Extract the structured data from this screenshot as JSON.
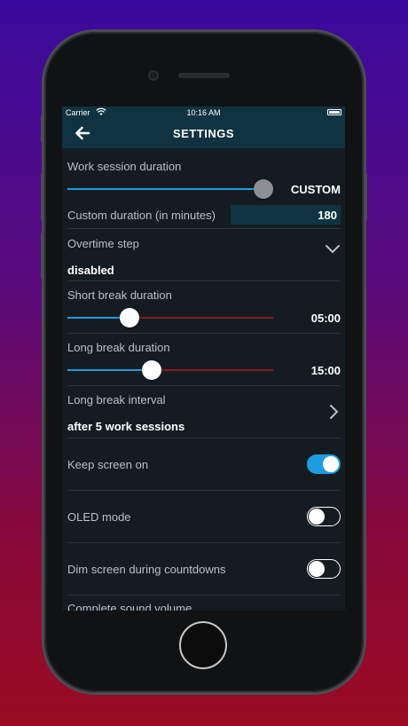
{
  "status": {
    "carrier": "Carrier",
    "time": "10:16 AM"
  },
  "nav": {
    "title": "SETTINGS"
  },
  "work_session": {
    "label": "Work session duration",
    "value": "CUSTOM",
    "slider_fraction": 1.0
  },
  "custom_duration": {
    "label": "Custom duration (in minutes)",
    "value": "180"
  },
  "overtime": {
    "label": "Overtime step",
    "value": "disabled"
  },
  "short_break": {
    "label": "Short break duration",
    "value": "05:00",
    "slider_fraction": 0.3
  },
  "long_break": {
    "label": "Long break duration",
    "value": "15:00",
    "slider_fraction": 0.41
  },
  "long_break_interval": {
    "label": "Long break interval",
    "value": "after 5 work sessions"
  },
  "keep_screen_on": {
    "label": "Keep screen on",
    "enabled": true
  },
  "oled_mode": {
    "label": "OLED mode",
    "enabled": false
  },
  "dim_screen": {
    "label": "Dim screen during countdowns",
    "enabled": false
  },
  "complete_sound": {
    "label": "Complete sound volume"
  },
  "colors": {
    "accent": "#1d9de0",
    "track_remaining": "#8a1a1a",
    "navbar": "#0f3340",
    "background": "#141c22"
  }
}
